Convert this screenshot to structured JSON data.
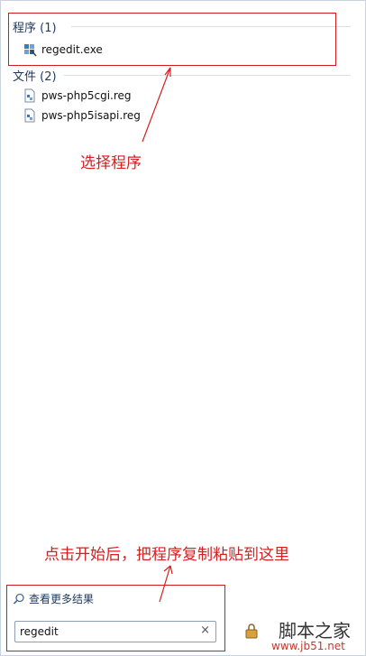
{
  "results": {
    "programs_header": "程序 (1)",
    "programs": [
      {
        "label": "regedit.exe",
        "icon": "regedit-app-icon"
      }
    ],
    "files_header": "文件 (2)",
    "files": [
      {
        "label": "pws-php5cgi.reg",
        "icon": "registry-file-icon"
      },
      {
        "label": "pws-php5isapi.reg",
        "icon": "registry-file-icon"
      }
    ]
  },
  "annotations": {
    "select_program": "选择程序",
    "paste_instruction": "点击开始后，把程序复制粘贴到这里"
  },
  "footer": {
    "see_more": "查看更多结果",
    "search_value": "regedit",
    "clear_symbol": "×"
  },
  "watermark": {
    "title": "脚本之家",
    "url": "www.jb51.net"
  },
  "colors": {
    "annotation": "#d42020",
    "header": "#1e395b"
  }
}
